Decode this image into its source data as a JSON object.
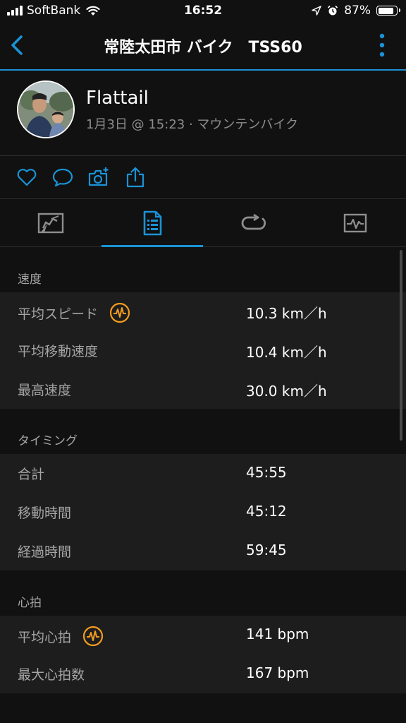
{
  "status_bar": {
    "carrier": "SoftBank",
    "time": "16:52",
    "battery": "87%",
    "battery_level": 0.87
  },
  "header": {
    "title": "常陸太田市 バイク　TSS60"
  },
  "activity": {
    "user_name": "Flattail",
    "meta": "1月3日 @ 15:23 · マウンテンバイク"
  },
  "actions": [
    {
      "icon": "heart-icon"
    },
    {
      "icon": "comment-icon"
    },
    {
      "icon": "add-photo-icon"
    },
    {
      "icon": "share-icon"
    }
  ],
  "tabs": [
    {
      "icon": "map-icon",
      "active": false
    },
    {
      "icon": "stats-list-icon",
      "active": true
    },
    {
      "icon": "laps-icon",
      "active": false
    },
    {
      "icon": "chart-icon",
      "active": false
    }
  ],
  "sections": {
    "speed": {
      "title": "速度",
      "rows": [
        {
          "label": "平均スピード",
          "value": "10.3 km／h"
        },
        {
          "label": "平均移動速度",
          "value": "10.4 km／h"
        },
        {
          "label": "最高速度",
          "value": "30.0 km／h"
        }
      ]
    },
    "timing": {
      "title": "タイミング",
      "rows": [
        {
          "label": "合計",
          "value": "45:55"
        },
        {
          "label": "移動時間",
          "value": "45:12"
        },
        {
          "label": "経過時間",
          "value": "59:45"
        }
      ]
    },
    "heart_rate": {
      "title": "心拍",
      "rows": [
        {
          "label": "平均心拍",
          "value": "141 bpm"
        },
        {
          "label": "最大心拍数",
          "value": "167 bpm"
        }
      ]
    }
  },
  "colors": {
    "accent": "#1a93d6",
    "badge": "#f39c1f",
    "background": "#111111",
    "row_background": "#1d1d1d",
    "secondary_text": "#a5a5a5"
  }
}
